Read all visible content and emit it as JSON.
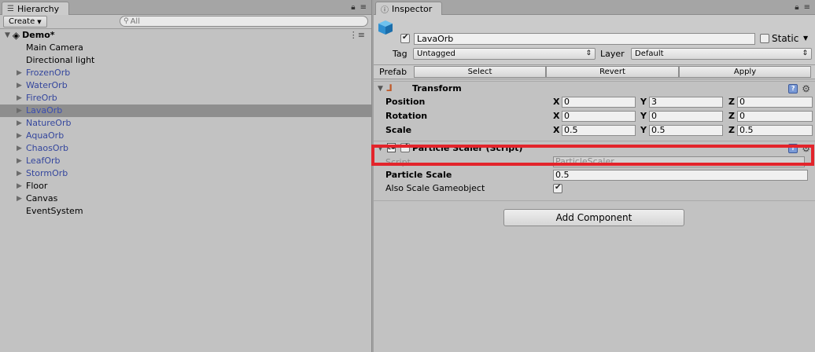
{
  "hierarchy": {
    "tab_label": "Hierarchy",
    "create_label": "Create",
    "search_placeholder": "All",
    "scene_name": "Demo*",
    "items": [
      {
        "label": "Main Camera",
        "prefab": false,
        "expandable": false
      },
      {
        "label": "Directional light",
        "prefab": false,
        "expandable": false
      },
      {
        "label": "FrozenOrb",
        "prefab": true,
        "expandable": true
      },
      {
        "label": "WaterOrb",
        "prefab": true,
        "expandable": true
      },
      {
        "label": "FireOrb",
        "prefab": true,
        "expandable": true
      },
      {
        "label": "LavaOrb",
        "prefab": true,
        "expandable": true,
        "selected": true
      },
      {
        "label": "NatureOrb",
        "prefab": true,
        "expandable": true
      },
      {
        "label": "AquaOrb",
        "prefab": true,
        "expandable": true
      },
      {
        "label": "ChaosOrb",
        "prefab": true,
        "expandable": true
      },
      {
        "label": "LeafOrb",
        "prefab": true,
        "expandable": true
      },
      {
        "label": "StormOrb",
        "prefab": true,
        "expandable": true
      },
      {
        "label": "Floor",
        "prefab": false,
        "expandable": true
      },
      {
        "label": "Canvas",
        "prefab": false,
        "expandable": true
      },
      {
        "label": "EventSystem",
        "prefab": false,
        "expandable": false
      }
    ]
  },
  "inspector": {
    "tab_label": "Inspector",
    "object_name": "LavaOrb",
    "static_label": "Static",
    "tag_label": "Tag",
    "tag_value": "Untagged",
    "layer_label": "Layer",
    "layer_value": "Default",
    "prefab_label": "Prefab",
    "select_label": "Select",
    "revert_label": "Revert",
    "apply_label": "Apply",
    "transform": {
      "title": "Transform",
      "position_label": "Position",
      "rotation_label": "Rotation",
      "scale_label": "Scale",
      "x": "X",
      "y": "Y",
      "z": "Z",
      "position": [
        "0",
        "3",
        "0"
      ],
      "rotation": [
        "0",
        "0",
        "0"
      ],
      "scale": [
        "0.5",
        "0.5",
        "0.5"
      ]
    },
    "scaler": {
      "title": "Particle Scaler (Script)",
      "script_label": "Script",
      "script_value": "ParticleScaler",
      "particle_scale_label": "Particle Scale",
      "particle_scale_value": "0.5",
      "also_scale_label": "Also Scale Gameobject"
    },
    "add_component_label": "Add Component"
  },
  "colors": {
    "highlight": "#e3242b",
    "prefab_text": "#34469d",
    "selected_row": "#8e8e8e"
  }
}
